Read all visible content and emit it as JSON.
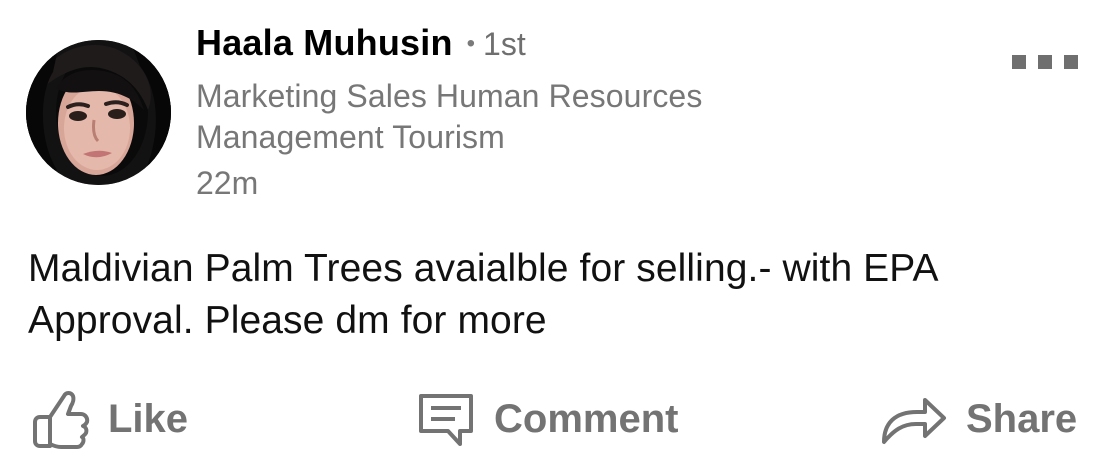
{
  "post": {
    "author": {
      "name": "Haala Muhusin",
      "connection_dot": "•",
      "connection_degree": "1st",
      "headline": "Marketing Sales Human Resources Management Tourism",
      "time_ago": "22m",
      "avatar_icon": "profile-photo"
    },
    "body_text": "Maldivian Palm Trees avaialble for selling.- with EPA Approval. Please dm for more",
    "menu_icon": "more-horizontal-icon",
    "actions": {
      "like": {
        "label": "Like",
        "icon": "thumbs-up-icon"
      },
      "comment": {
        "label": "Comment",
        "icon": "comment-icon"
      },
      "share": {
        "label": "Share",
        "icon": "share-arrow-icon"
      }
    },
    "colors": {
      "primary_text": "#000000",
      "secondary_text": "#777777",
      "action_text": "#737373",
      "background": "#ffffff"
    }
  }
}
